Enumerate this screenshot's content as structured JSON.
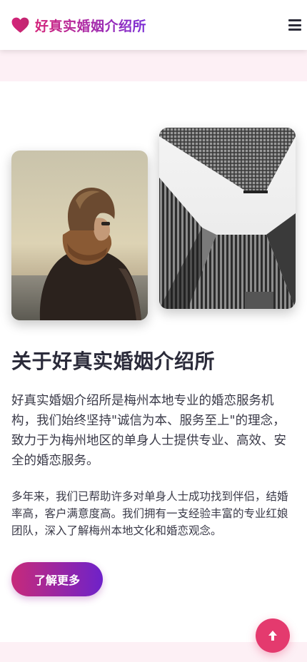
{
  "header": {
    "logo_text": "好真实婚姻介绍所"
  },
  "about": {
    "title": "关于好真实婚姻介绍所",
    "paragraph1": "好真实婚姻介绍所是梅州本地专业的婚恋服务机构，我们始终坚持\"诚信为本、服务至上\"的理念，致力于为梅州地区的单身人士提供专业、高效、安全的婚恋服务。",
    "paragraph2": "多年来，我们已帮助许多对单身人士成功找到伴侣，结婚率高，客户满意度高。我们拥有一支经验丰富的专业红娘团队，深入了解梅州本地文化和婚恋观念。",
    "button_label": "了解更多"
  },
  "icons": {
    "logo": "heart-icon",
    "menu": "hamburger-menu-icon",
    "back_to_top": "arrow-up-icon"
  },
  "colors": {
    "brand_pink": "#d4247a",
    "brand_purple": "#7b2fd6",
    "back_to_top": "#e43a6e",
    "section_tint": "#fdf0f5"
  }
}
